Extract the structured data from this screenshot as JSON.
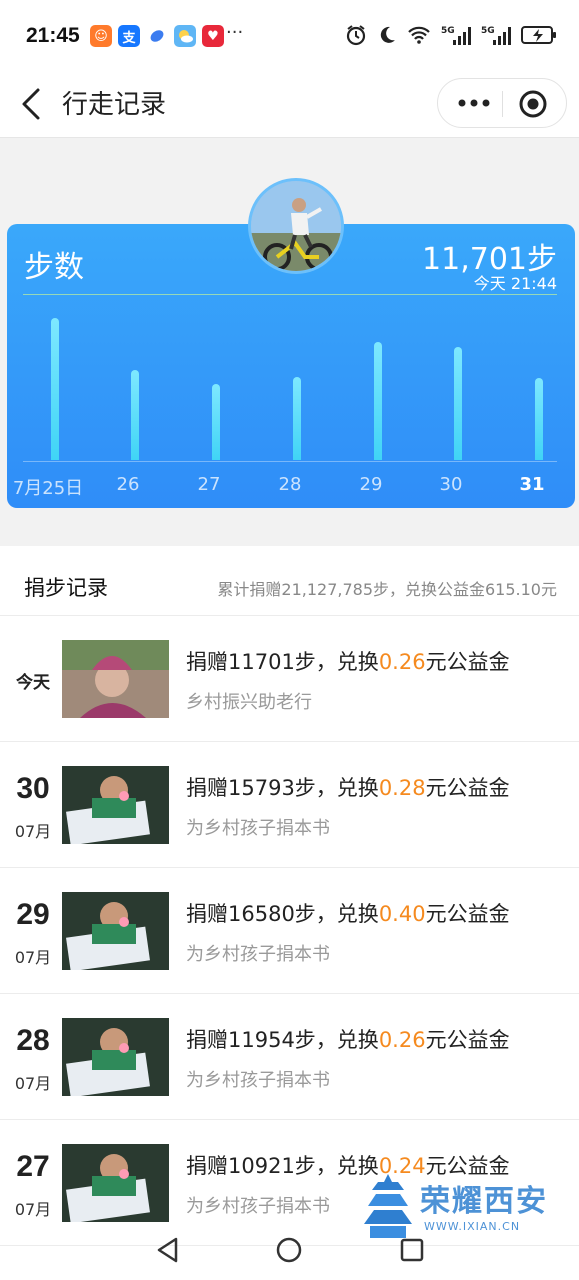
{
  "status_bar": {
    "time": "21:45",
    "more": "···",
    "icons": [
      "taobao-icon",
      "alipay-icon",
      "blue-app-icon",
      "weather-icon",
      "health-icon"
    ],
    "right_icons": [
      "alarm-icon",
      "moon-icon",
      "wifi-icon",
      "signal-5g-icon",
      "signal-5g-icon",
      "battery-charging-icon"
    ]
  },
  "nav": {
    "title": "行走记录"
  },
  "card": {
    "label": "步数",
    "steps": "11,701步",
    "when": "今天 21:44",
    "chart_data": {
      "type": "bar",
      "categories": [
        "7月25日",
        "26",
        "27",
        "28",
        "29",
        "30",
        "31"
      ],
      "values": [
        16500,
        10500,
        8800,
        9700,
        13700,
        13100,
        9500
      ],
      "highlight": "31"
    }
  },
  "records": {
    "title": "捐步记录",
    "summary": "累计捐赠21,127,785步，兑换公益金615.10元",
    "items": [
      {
        "day": "今天",
        "month": "",
        "text1": "捐赠11701步，兑换",
        "amount": "0.26",
        "text2": "元公益金",
        "project": "乡村振兴助老行"
      },
      {
        "day": "30",
        "month": "07月",
        "text1": "捐赠15793步，兑换",
        "amount": "0.28",
        "text2": "元公益金",
        "project": "为乡村孩子捐本书"
      },
      {
        "day": "29",
        "month": "07月",
        "text1": "捐赠16580步，兑换",
        "amount": "0.40",
        "text2": "元公益金",
        "project": "为乡村孩子捐本书"
      },
      {
        "day": "28",
        "month": "07月",
        "text1": "捐赠11954步，兑换",
        "amount": "0.26",
        "text2": "元公益金",
        "project": "为乡村孩子捐本书"
      },
      {
        "day": "27",
        "month": "07月",
        "text1": "捐赠10921步，兑换",
        "amount": "0.24",
        "text2": "元公益金",
        "project": "为乡村孩子捐本书"
      }
    ]
  },
  "watermark": {
    "text": "荣耀西安",
    "url": "WWW.IXIAN.CN"
  },
  "colors": {
    "card_top": "#3aa8fa",
    "card_bottom": "#2f8df8",
    "bar": "#4fdcf8",
    "amount": "#f58a1f"
  }
}
